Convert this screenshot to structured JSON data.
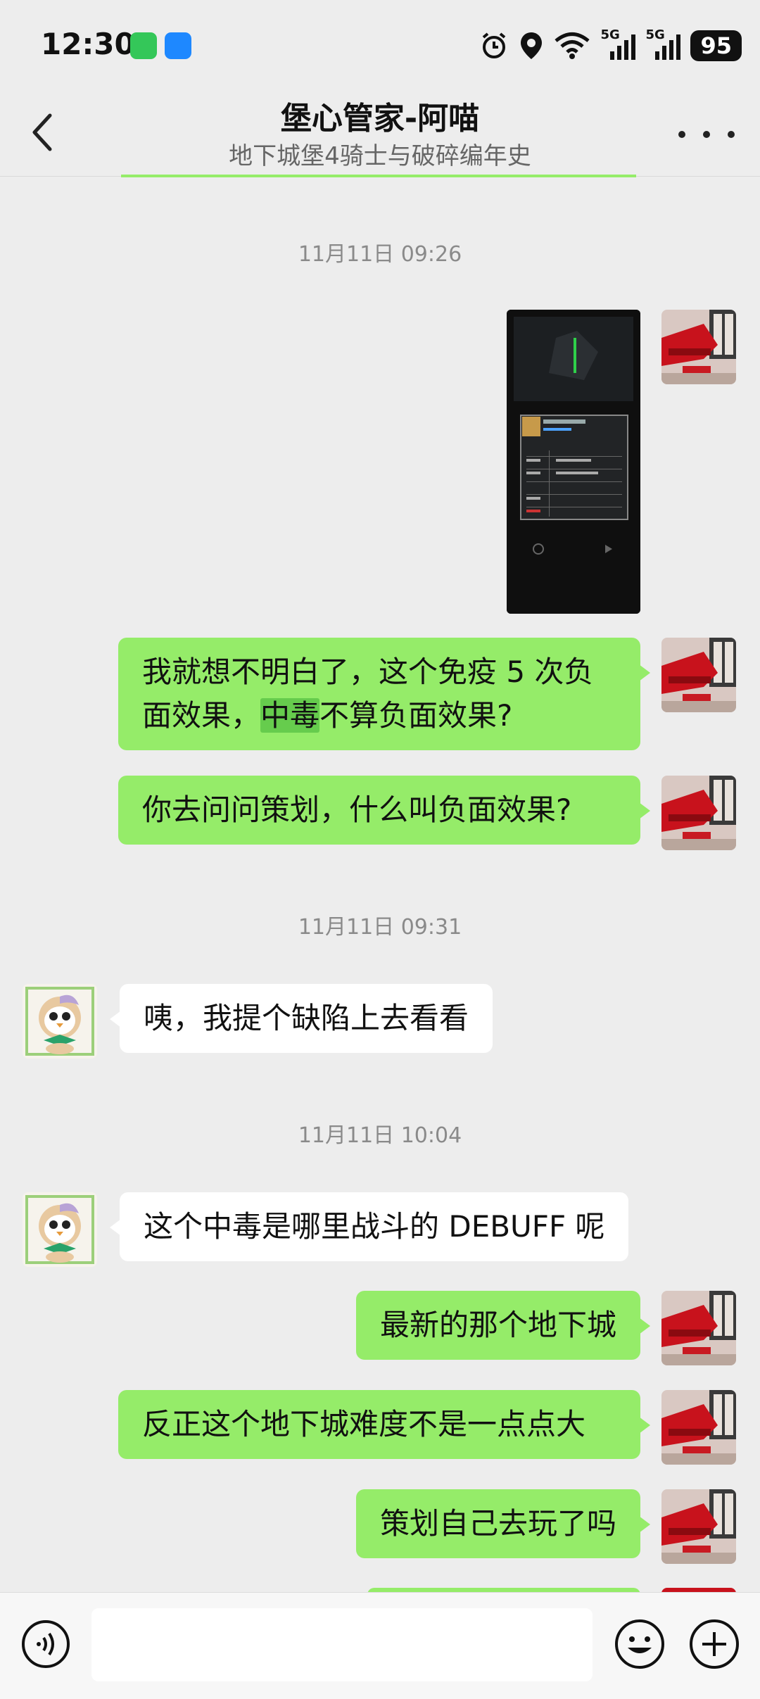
{
  "status_bar": {
    "time": "12:30",
    "battery": "95",
    "signal_label_1": "5G",
    "signal_label_2": "5G"
  },
  "header": {
    "title": "堡心管家-阿喵",
    "subtitle": "地下城堡4骑士与破碎编年史"
  },
  "timestamps": [
    "11月11日 09:26",
    "11月11日 09:31",
    "11月11日 10:04"
  ],
  "messages": {
    "m1_pre": "我就想不明白了，这个免疫 5 次负",
    "m1_line2_pre": "面效果，",
    "m1_highlight": "中毒",
    "m1_line2_post": "不算负面效果?",
    "m2": "你去问问策划，什么叫负面效果?",
    "m3": "咦，我提个缺陷上去看看",
    "m4": "这个中毒是哪里战斗的 DEBUFF 呢",
    "m5": "最新的那个地下城",
    "m6": "反正这个地下城难度不是一点点大",
    "m7": "策划自己去玩了吗"
  },
  "colors": {
    "bubble_self": "#95ec69",
    "bubble_other": "#ffffff",
    "background": "#ededed",
    "highlight": "#66cc4d"
  },
  "icons": [
    "back-icon",
    "more-icon",
    "voice-icon",
    "emoji-icon",
    "plus-icon",
    "alarm-icon",
    "location-icon",
    "wifi-icon"
  ]
}
